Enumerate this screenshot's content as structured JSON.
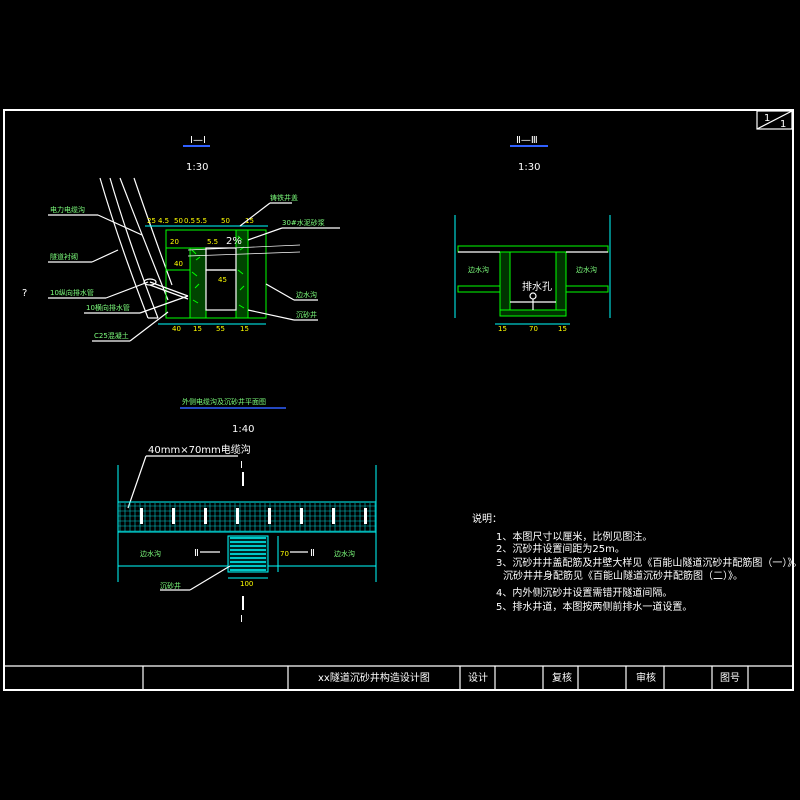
{
  "sheet": {
    "sheet_no": "1",
    "sheet_total": "1"
  },
  "section_1": {
    "title": "Ⅰ—Ⅰ",
    "scale": "1:30",
    "labels": {
      "cable_trench": "电力电缆沟",
      "tunnel_lining": "隧道衬砌",
      "question": "?",
      "longitudinal_pipe": "10纵向排水管",
      "transverse_pipe": "10横向排水管",
      "concrete": "C25混凝土",
      "cover": "铸铁井盖",
      "mortar": "30#水泥砂浆",
      "side_ditch": "边水沟",
      "sand_well": "沉砂井"
    },
    "dims_top": [
      "25",
      "4.5",
      "50",
      "0.5",
      "5.5",
      "50",
      "15"
    ],
    "dims_bottom": [
      "40",
      "15",
      "55",
      "15"
    ],
    "dims_side": [
      "20",
      "40",
      "5.5",
      "45",
      "2%"
    ]
  },
  "section_2": {
    "title": "Ⅱ—Ⅲ",
    "scale": "1:30",
    "labels": {
      "left": "边水沟",
      "right": "边水沟",
      "center": "排水孔"
    },
    "dims_bottom": [
      "15",
      "70",
      "15"
    ]
  },
  "plan": {
    "title": "外侧电缆沟及沉砂井平面图",
    "scale": "1:40",
    "trench_size": "40mm×70mm电缆沟",
    "cut_mark": "Ⅰ",
    "mark_2_left": "Ⅱ",
    "mark_2_right": "Ⅱ",
    "left_ditch": "边水沟",
    "right_ditch": "边水沟",
    "sand_well": "沉砂井",
    "dim_width": "100",
    "dim_depth": "70"
  },
  "notes": {
    "heading": "说明：",
    "items": [
      "1、本图尺寸以厘米，比例见图注。",
      "2、沉砂井设置间距为25m。",
      "3、沉砂井井盖配筋及井壁大样见《百能山隧道沉砂井配筋图（一）》。",
      "沉砂井井身配筋见《百能山隧道沉砂井配筋图（二）》。",
      "4、内外侧沉砂井设置需错开隧道间隔。",
      "5、排水井道，本图按两侧前排水一道设置。"
    ]
  },
  "title_block": {
    "title": "xx隧道沉砂井构造设计图",
    "design": "设计",
    "review": "复核",
    "approve": "审核",
    "drawing_no": "图号"
  }
}
